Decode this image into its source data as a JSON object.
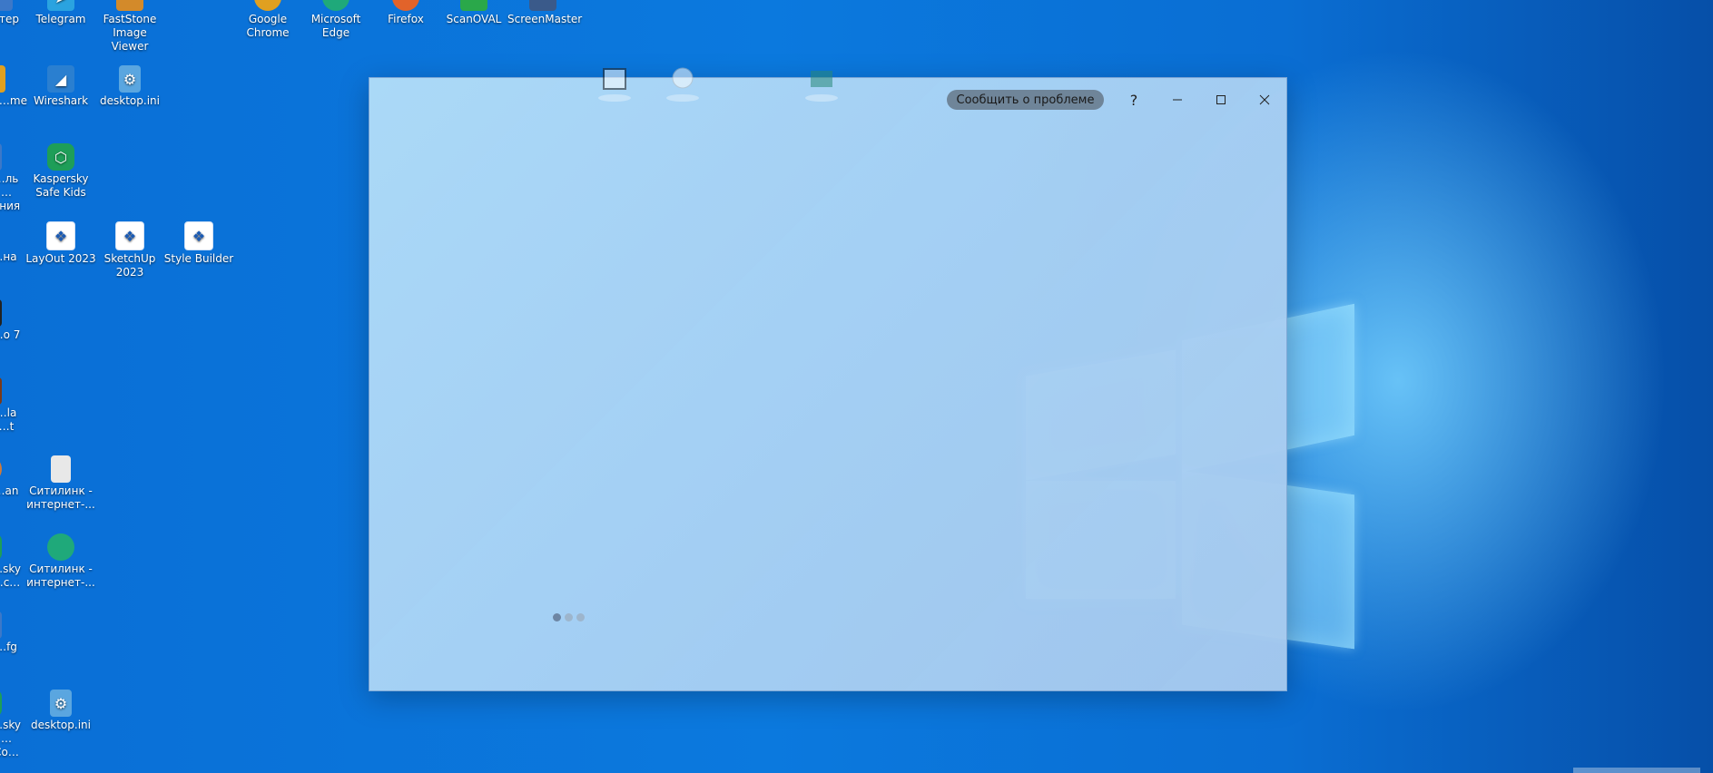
{
  "desktop": {
    "icons": [
      {
        "label": "…ютер",
        "icon": "computer-icon",
        "color": "#3c78c8"
      },
      {
        "label": "Telegram",
        "icon": "telegram-icon",
        "color": "#2aa3e0"
      },
      {
        "label": "FastStone Image Viewer",
        "icon": "faststone-icon",
        "color": "#d38a2a"
      },
      {
        "label": "Google Chrome",
        "icon": "chrome-icon",
        "color": "#e0a020"
      },
      {
        "label": "Microsoft Edge",
        "icon": "edge-icon",
        "color": "#1fa97a"
      },
      {
        "label": "Firefox",
        "icon": "firefox-icon",
        "color": "#e2632a"
      },
      {
        "label": "ScanOVAL",
        "icon": "scanoval-icon",
        "color": "#2aa84a"
      },
      {
        "label": "ScreenMaster",
        "icon": "screenmaster-icon",
        "color": "#3a5a8a"
      },
      {
        "label": "…me",
        "icon": "app-icon",
        "color": "#e0a020"
      },
      {
        "label": "Wireshark",
        "icon": "wireshark-icon",
        "color": "#2a7fd0"
      },
      {
        "label": "desktop.ini",
        "icon": "settings-file-icon",
        "color": "#5aa6e0"
      },
      {
        "label": "…ль …ения",
        "icon": "control-panel-icon",
        "color": "#3c78c8"
      },
      {
        "label": "Kaspersky Safe Kids",
        "icon": "kaspersky-icon",
        "color": "#1e9e58"
      },
      {
        "label": "…на",
        "icon": "app-icon",
        "color": "#3c78c8"
      },
      {
        "label": "LayOut 2023",
        "icon": "layout-icon",
        "color": "#1a5bb5"
      },
      {
        "label": "SketchUp 2023",
        "icon": "sketchup-icon",
        "color": "#1a5bb5"
      },
      {
        "label": "Style Builder",
        "icon": "stylebuilder-icon",
        "color": "#1a5bb5"
      },
      {
        "label": "…o 7",
        "icon": "app-icon",
        "color": "#222222"
      },
      {
        "label": "…la …t",
        "icon": "app-icon",
        "color": "#7a3a1a"
      },
      {
        "label": "…an",
        "icon": "app-icon",
        "color": "#d07a3a"
      },
      {
        "label": "Ситилинк - интернет-...",
        "icon": "document-icon",
        "color": "#e8e8e8"
      },
      {
        "label": "…sky …c…",
        "icon": "kaspersky-icon",
        "color": "#1e9e58"
      },
      {
        "label": "Ситилинк - интернет-...",
        "icon": "edge-icon",
        "color": "#1fa97a"
      },
      {
        "label": "…fg",
        "icon": "app-icon",
        "color": "#3c78c8"
      },
      {
        "label": "…sky …Co…",
        "icon": "kaspersky-icon",
        "color": "#1e9e58"
      },
      {
        "label": "desktop.ini",
        "icon": "settings-file-icon",
        "color": "#5aa6e0"
      }
    ]
  },
  "dialog": {
    "report_label": "Сообщить о проблеме",
    "help_glyph": "?",
    "minimize_glyph": "–",
    "maximize_glyph": "☐",
    "close_glyph": "✕",
    "carousel_pages": 3,
    "carousel_active": 1
  }
}
